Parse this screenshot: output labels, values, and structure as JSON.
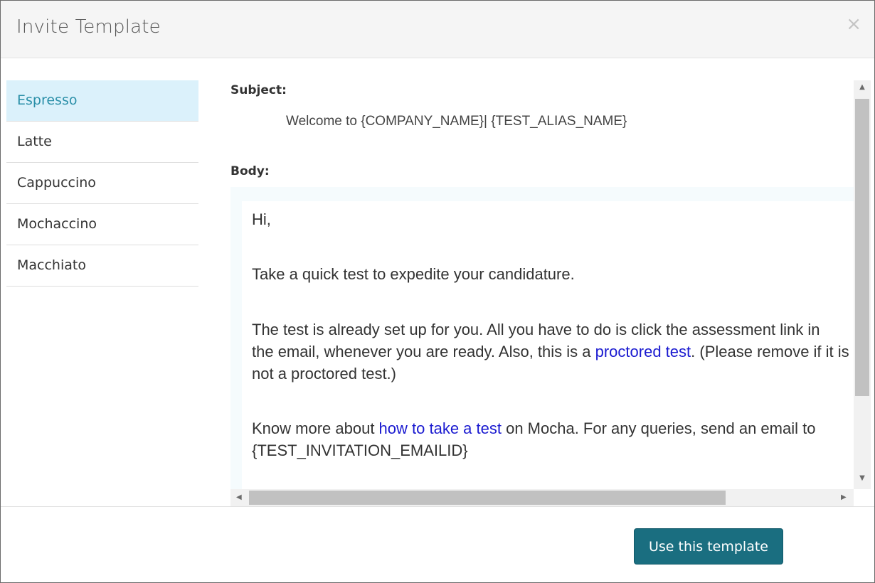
{
  "modal": {
    "title": "Invite Template",
    "close_glyph": "×"
  },
  "sidebar": {
    "items": [
      {
        "label": "Espresso",
        "active": true
      },
      {
        "label": "Latte",
        "active": false
      },
      {
        "label": "Cappuccino",
        "active": false
      },
      {
        "label": "Mochaccino",
        "active": false
      },
      {
        "label": "Macchiato",
        "active": false
      }
    ]
  },
  "template": {
    "subject_label": "Subject:",
    "subject_value": "Welcome to {COMPANY_NAME}| {TEST_ALIAS_NAME}",
    "body_label": "Body:",
    "body": {
      "greeting": "Hi,",
      "line1": "Take a quick test to expedite your candidature.",
      "para2_part1": "The test is already set up for you. All you have to do is click the assessment link in",
      "para2_part2": "the email, whenever you are ready. Also, this is a ",
      "para2_link": "proctored test",
      "para2_part3": ". (Please remove if it is",
      "para2_part4": "not a proctored test.)",
      "para3_part1": "Know more about ",
      "para3_link": "how to take a test",
      "para3_part2": " on Mocha. For any queries, send an email to",
      "para3_part3": "{TEST_INVITATION_EMAILID}"
    }
  },
  "footer": {
    "use_template_label": "Use this template"
  },
  "colors": {
    "primary_button": "#1a6e80",
    "active_item_bg": "#dbf1fb",
    "active_item_text": "#2a8fa8",
    "link": "#1a1ad0"
  }
}
